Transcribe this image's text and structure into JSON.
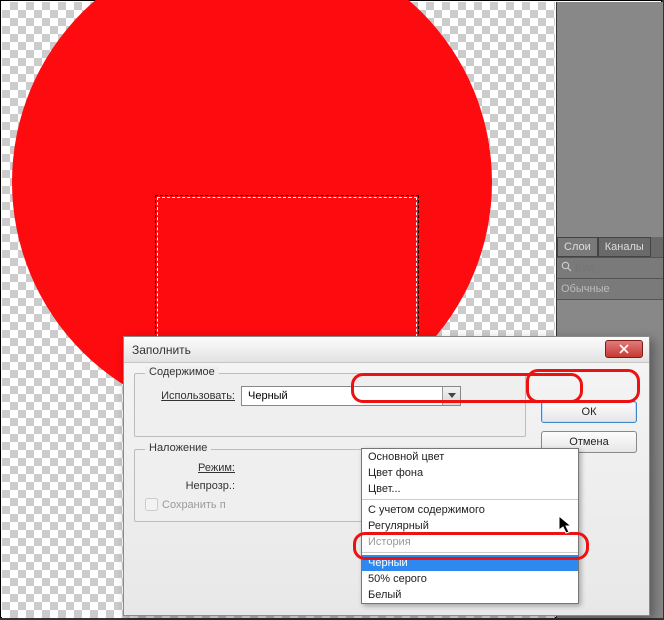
{
  "panel": {
    "tab_layers": "Слои",
    "tab_channels": "Каналы",
    "search_placeholder": "Вид",
    "mode_label": "Обычные"
  },
  "dialog": {
    "title": "Заполнить",
    "ok": "ОК",
    "cancel": "Отмена",
    "content_legend": "Содержимое",
    "use_label": "Использовать:",
    "use_value": "Черный",
    "blend_legend": "Наложение",
    "mode_label": "Режим:",
    "opacity_label": "Непрозр.:",
    "preserve_label": "Сохранить п",
    "options": [
      "Основной цвет",
      "Цвет фона",
      "Цвет...",
      "С учетом содержимого",
      "Регулярный",
      "История",
      "Черный",
      "50% серого",
      "Белый"
    ]
  }
}
